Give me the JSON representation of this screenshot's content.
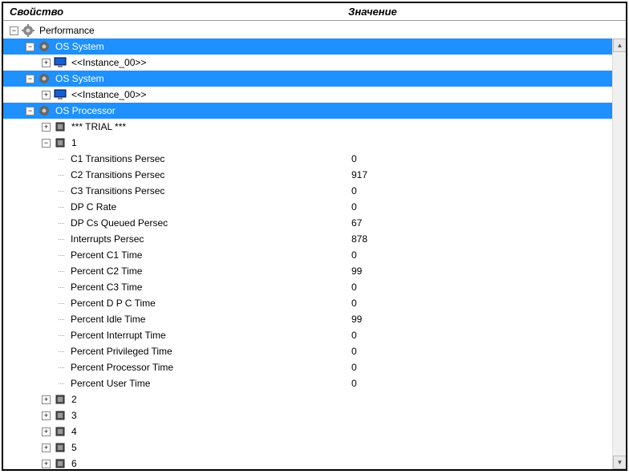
{
  "header": {
    "property": "Свойство",
    "value": "Значение"
  },
  "root": {
    "label": "Performance"
  },
  "os_system_1": {
    "label": "OS System",
    "instance": "<<Instance_00>>"
  },
  "os_system_2": {
    "label": "OS System",
    "instance": "<<Instance_00>>"
  },
  "os_processor": {
    "label": "OS Processor"
  },
  "trial": {
    "label": "*** TRIAL ***"
  },
  "cpu1": {
    "label": "1"
  },
  "metrics": [
    {
      "name": "C1 Transitions Persec",
      "value": "0"
    },
    {
      "name": "C2 Transitions Persec",
      "value": "917"
    },
    {
      "name": "C3 Transitions Persec",
      "value": "0"
    },
    {
      "name": "DP C Rate",
      "value": "0"
    },
    {
      "name": "DP Cs Queued Persec",
      "value": "67"
    },
    {
      "name": "Interrupts Persec",
      "value": "878"
    },
    {
      "name": "Percent C1 Time",
      "value": "0"
    },
    {
      "name": "Percent C2 Time",
      "value": "99"
    },
    {
      "name": "Percent C3 Time",
      "value": "0"
    },
    {
      "name": "Percent D P C Time",
      "value": "0"
    },
    {
      "name": "Percent Idle Time",
      "value": "99"
    },
    {
      "name": "Percent Interrupt Time",
      "value": "0"
    },
    {
      "name": "Percent Privileged Time",
      "value": "0"
    },
    {
      "name": "Percent Processor Time",
      "value": "0"
    },
    {
      "name": "Percent User Time",
      "value": "0"
    }
  ],
  "cpus_collapsed": [
    {
      "label": "2"
    },
    {
      "label": "3"
    },
    {
      "label": "4"
    },
    {
      "label": "5"
    },
    {
      "label": "6"
    }
  ],
  "glyphs": {
    "plus": "+",
    "minus": "−",
    "up": "▲",
    "down": "▼"
  }
}
